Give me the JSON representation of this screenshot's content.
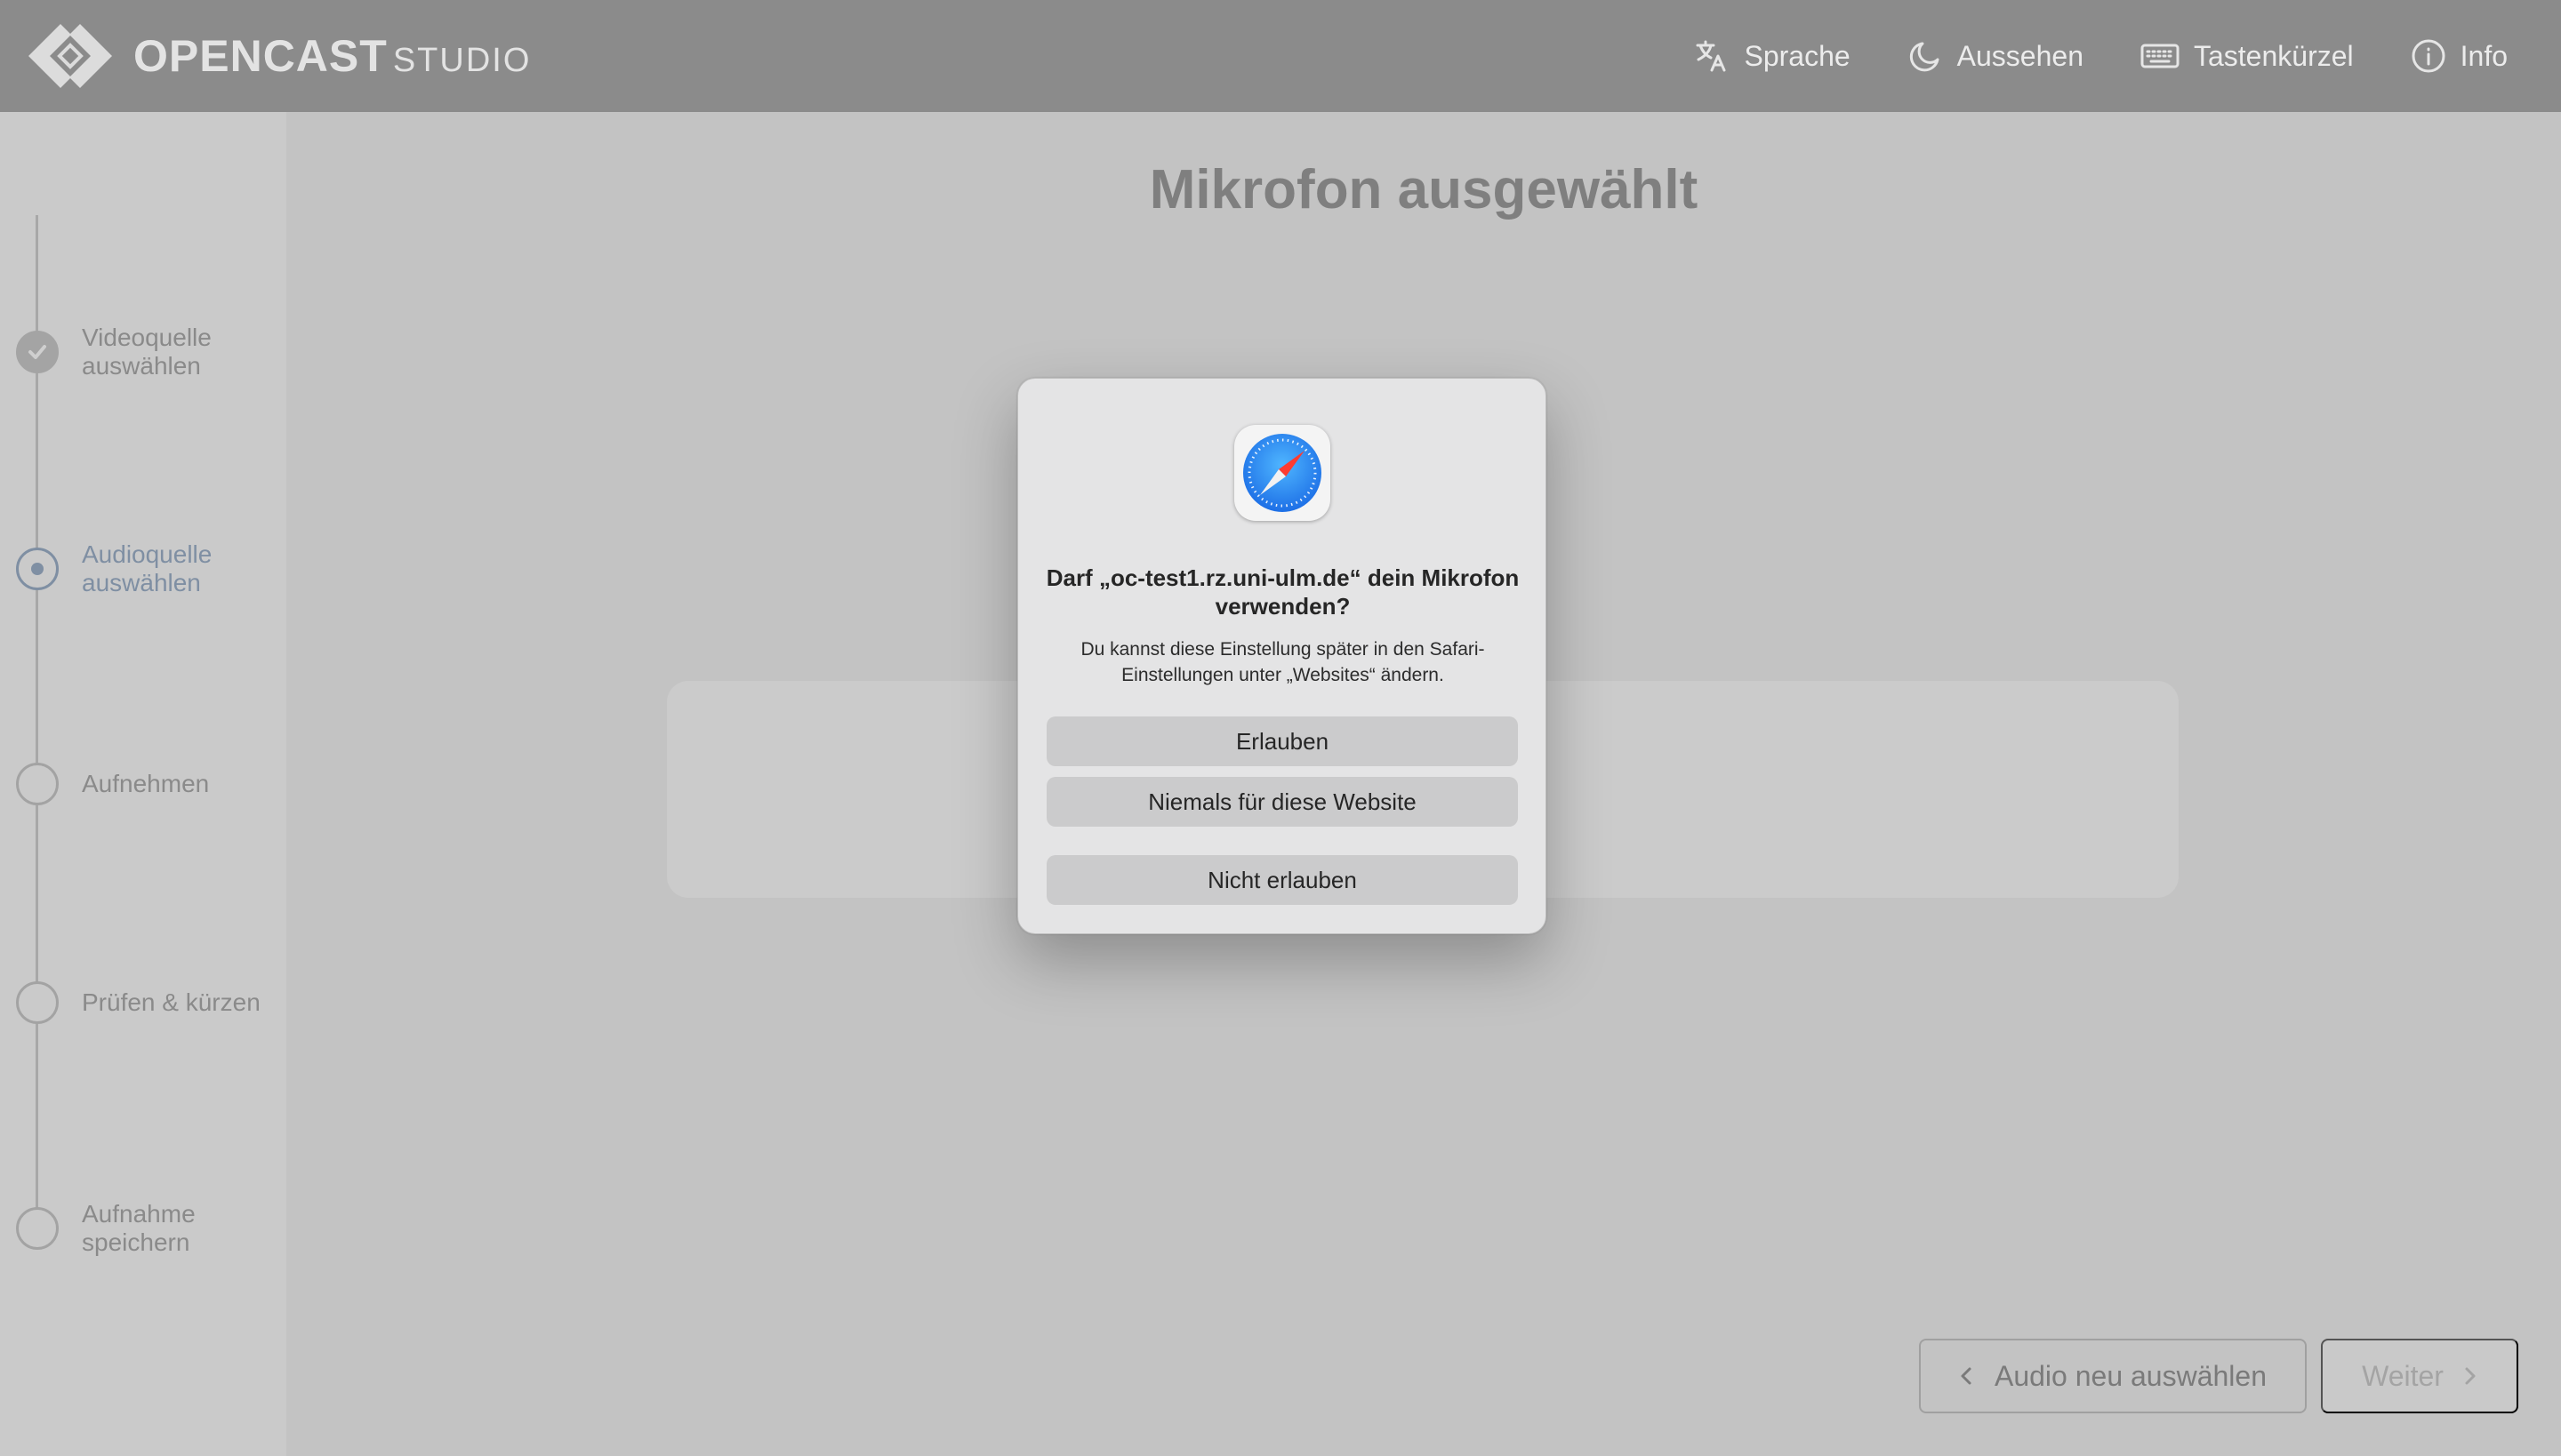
{
  "header": {
    "logo_main": "OPENCAST",
    "logo_sub": "STUDIO",
    "nav": [
      {
        "label": "Sprache",
        "icon": "translate-icon"
      },
      {
        "label": "Aussehen",
        "icon": "moon-icon"
      },
      {
        "label": "Tastenkürzel",
        "icon": "keyboard-icon"
      },
      {
        "label": "Info",
        "icon": "info-icon"
      }
    ]
  },
  "sidebar": {
    "steps": [
      {
        "label": "Videoquelle auswählen",
        "state": "done"
      },
      {
        "label": "Audioquelle auswählen",
        "state": "current"
      },
      {
        "label": "Aufnehmen",
        "state": "pending"
      },
      {
        "label": "Prüfen & kürzen",
        "state": "pending"
      },
      {
        "label": "Aufnahme speichern",
        "state": "pending"
      }
    ]
  },
  "main": {
    "title": "Mikrofon ausgewählt",
    "back_label": "Audio neu auswählen",
    "next_label": "Weiter"
  },
  "dialog": {
    "title": "Darf „oc-test1.rz.uni-ulm.de“ dein Mikrofon verwenden?",
    "text": "Du kannst diese Einstellung später in den Safari-Einstellungen unter „Websites“ ändern.",
    "allow_label": "Erlauben",
    "never_label": "Niemals für diese Website",
    "deny_label": "Nicht erlauben",
    "app_icon": "safari-compass-icon"
  },
  "colors": {
    "header_bg": "#8b8b8b",
    "overlay_bg": "#c3c3c3",
    "accent": "#7f8fa3"
  }
}
